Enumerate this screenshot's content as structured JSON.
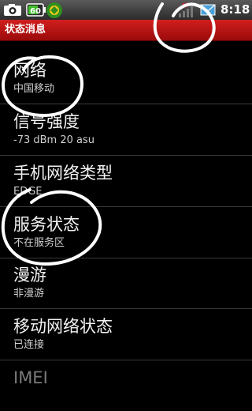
{
  "status_bar": {
    "time": "8:18",
    "battery_level": "60",
    "icons": [
      "camera-icon",
      "battery-icon",
      "app-icon",
      "signal-icon",
      "message-icon"
    ]
  },
  "header": {
    "title": "状态消息"
  },
  "items": [
    {
      "title": "网络",
      "summary": "中国移动"
    },
    {
      "title": "信号强度",
      "summary": "-73 dBm   20 asu"
    },
    {
      "title": "手机网络类型",
      "summary": "EDGE"
    },
    {
      "title": "服务状态",
      "summary": "不在服务区"
    },
    {
      "title": "漫游",
      "summary": "非漫游"
    },
    {
      "title": "移动网络状态",
      "summary": "已连接"
    },
    {
      "title": "IMEI",
      "summary": ""
    }
  ],
  "colors": {
    "title_bar": "#c41414",
    "background": "#000000",
    "annotation": "#ffffff"
  }
}
